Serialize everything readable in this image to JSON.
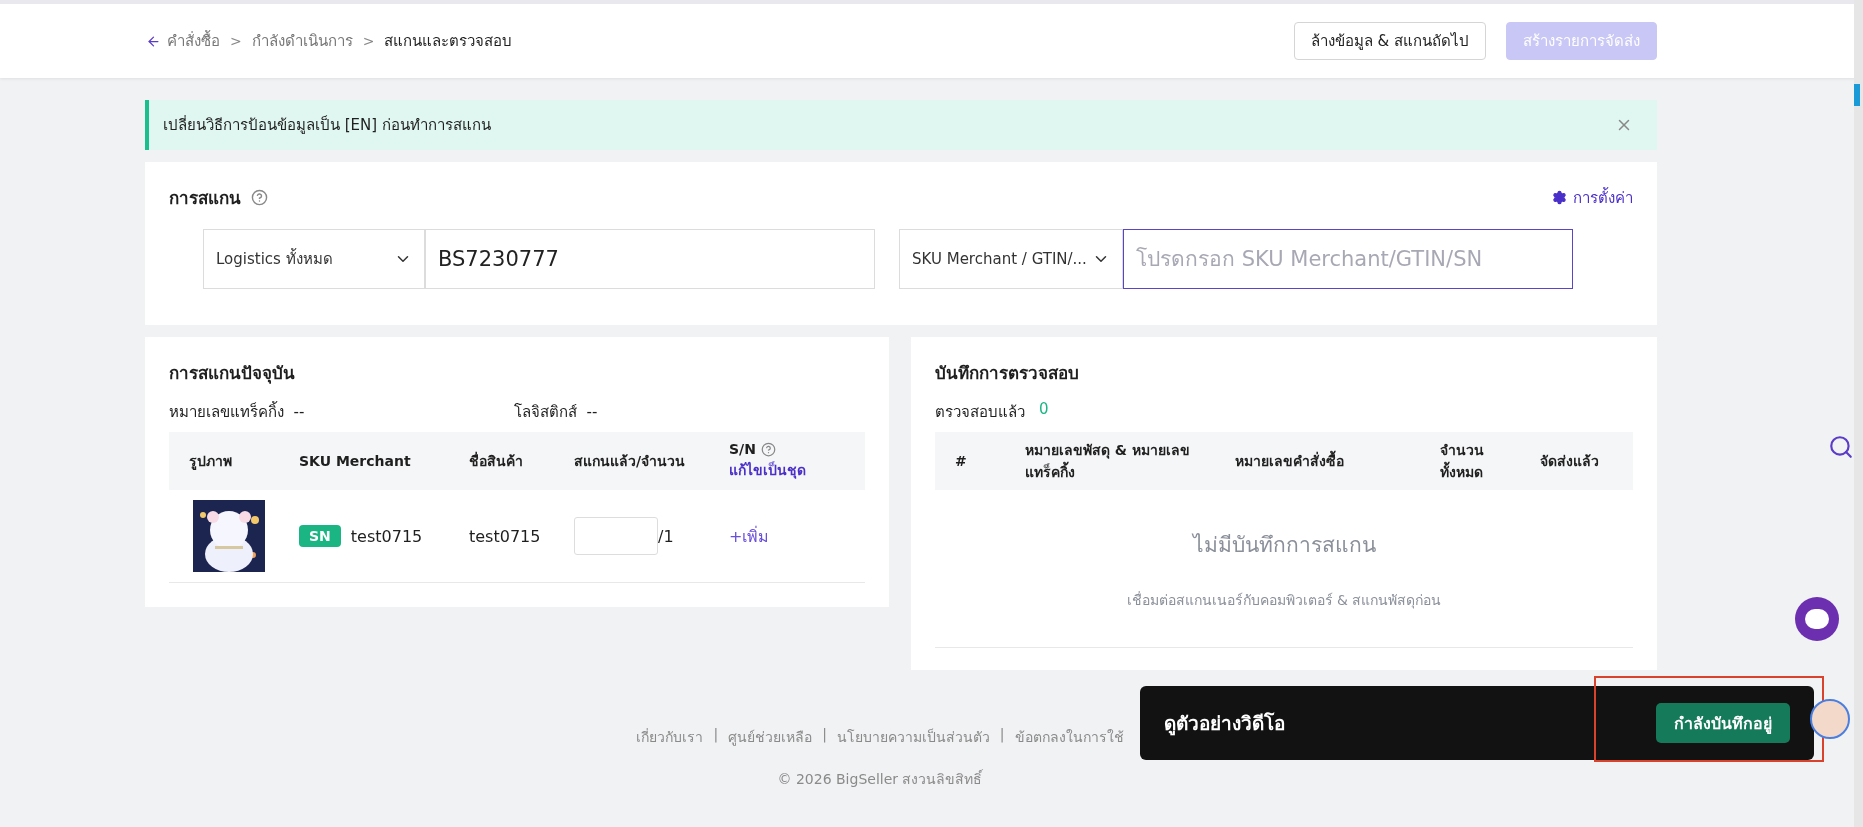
{
  "breadcrumb_separator": ">",
  "breadcrumb": [
    {
      "label": "คำสั่งซื้อ",
      "kind": "back"
    },
    {
      "label": "กำลังดำเนินการ",
      "kind": "link"
    },
    {
      "label": "สแกนและตรวจสอบ",
      "kind": "current"
    }
  ],
  "header_buttons": [
    {
      "label": "ล้างข้อมูล & สแกนถัดไป",
      "disabled": false
    },
    {
      "label": "สร้างรายการจัดส่ง",
      "disabled": true
    }
  ],
  "alert": {
    "text": "เปลี่ยนวิธีการป้อนข้อมูลเป็น [EN] ก่อนทำการสแกน"
  },
  "scan": {
    "title": "การสแกน",
    "settings": "การตั้งค่า",
    "logistics_select": "Logistics ทั้งหมด",
    "tracking_value": "BS7230777",
    "sku_select": "SKU Merchant / GTIN/...",
    "sku_placeholder": "โปรดกรอก SKU Merchant/GTIN/SN"
  },
  "current": {
    "title": "การสแกนปัจจุบัน",
    "fields": [
      {
        "label": "หมายเลขแทร็คกิ้ง",
        "value": "--"
      },
      {
        "label": "โลจิสติกส์",
        "value": "--"
      }
    ],
    "columns": [
      "รูปภาพ",
      "SKU Merchant",
      "ชื่อสินค้า",
      "สแกนแล้ว/จำนวน",
      "S/N"
    ],
    "batch_edit": "แก้ไขเป็นชุด",
    "rows": [
      {
        "badge": "SN",
        "sku": "test0715",
        "name": "test0715",
        "total": "/1",
        "action": "+เพิ่ม"
      }
    ]
  },
  "log": {
    "title": "บันทึกการตรวจสอบ",
    "checked_label": "ตรวจสอบแล้ว",
    "checked_count": "0",
    "columns": [
      "#",
      "หมายเลขพัสดุ & หมายเลขแทร็คกิ้ง",
      "หมายเลขคำสั่งซื้อ",
      "จำนวนทั้งหมด",
      "จัดส่งแล้ว"
    ],
    "empty_title": "ไม่มีบันทึกการสแกน",
    "empty_hint": "เชื่อมต่อสแกนเนอร์กับคอมพิวเตอร์ & สแกนพัสดุก่อน"
  },
  "footer": {
    "separator": "|",
    "links": [
      "เกี่ยวกับเรา",
      "ศูนย์ช่วยเหลือ",
      "นโยบายความเป็นส่วนตัว",
      "ข้อตกลงในการใช้"
    ],
    "copyright": "© 2026 BigSeller สงวนลิขสิทธิ์"
  },
  "toast": {
    "text": "ดูตัวอย่างวิดีโอ",
    "button": "กำลังบันทึกอยู่"
  }
}
